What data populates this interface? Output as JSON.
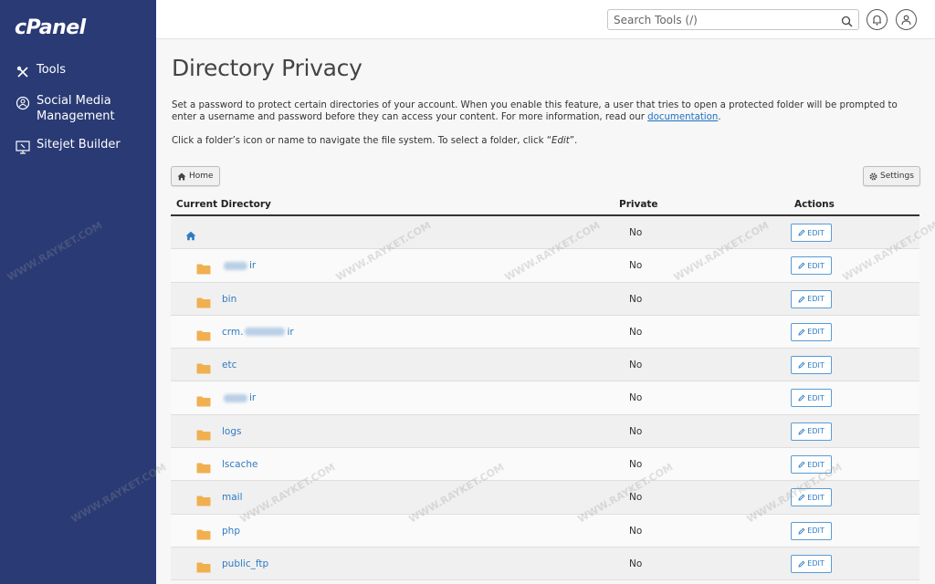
{
  "sidebar": {
    "logo": "cPanel",
    "items": [
      {
        "label": "Tools",
        "icon": "tools-icon"
      },
      {
        "label": "Social Media\nManagement",
        "icon": "social-media-icon"
      },
      {
        "label": "Sitejet Builder",
        "icon": "sitejet-icon"
      }
    ]
  },
  "header": {
    "search_placeholder": "Search Tools (/)"
  },
  "page": {
    "title": "Directory Privacy",
    "description_before": "Set a password to protect certain directories of your account. When you enable this feature, a user that tries to open a protected folder will be prompted to enter a username and password before they can access your content. For more information, read our ",
    "description_link": "documentation",
    "description_after": ".",
    "hint_before": "Click a folder’s icon or name to navigate the file system. To select a folder, click “",
    "hint_em": "Edit",
    "hint_after": "”.",
    "home_button": "Home",
    "settings_button": "Settings"
  },
  "table": {
    "headers": {
      "directory": "Current Directory",
      "private": "Private",
      "actions": "Actions"
    },
    "edit_label": "EDIT",
    "rows": [
      {
        "name": "",
        "type": "home",
        "private": "No"
      },
      {
        "name": "ir",
        "type": "folder",
        "blurred_prefix": true,
        "private": "No"
      },
      {
        "name": "bin",
        "type": "folder",
        "private": "No"
      },
      {
        "name_prefix": "crm.",
        "name": "ir",
        "type": "folder",
        "blurred_middle": true,
        "private": "No"
      },
      {
        "name": "etc",
        "type": "folder",
        "private": "No"
      },
      {
        "name": "ir",
        "type": "folder",
        "blurred_prefix": true,
        "private": "No"
      },
      {
        "name": "logs",
        "type": "folder",
        "private": "No"
      },
      {
        "name": "lscache",
        "type": "folder",
        "private": "No"
      },
      {
        "name": "mail",
        "type": "folder",
        "private": "No"
      },
      {
        "name": "php",
        "type": "folder",
        "private": "No"
      },
      {
        "name": "public_ftp",
        "type": "folder",
        "private": "No"
      }
    ]
  },
  "watermark": "WWW.RAYKET.COM",
  "colors": {
    "sidebar": "#293a74",
    "link": "#2e7bc4",
    "folder": "#f0b050"
  }
}
